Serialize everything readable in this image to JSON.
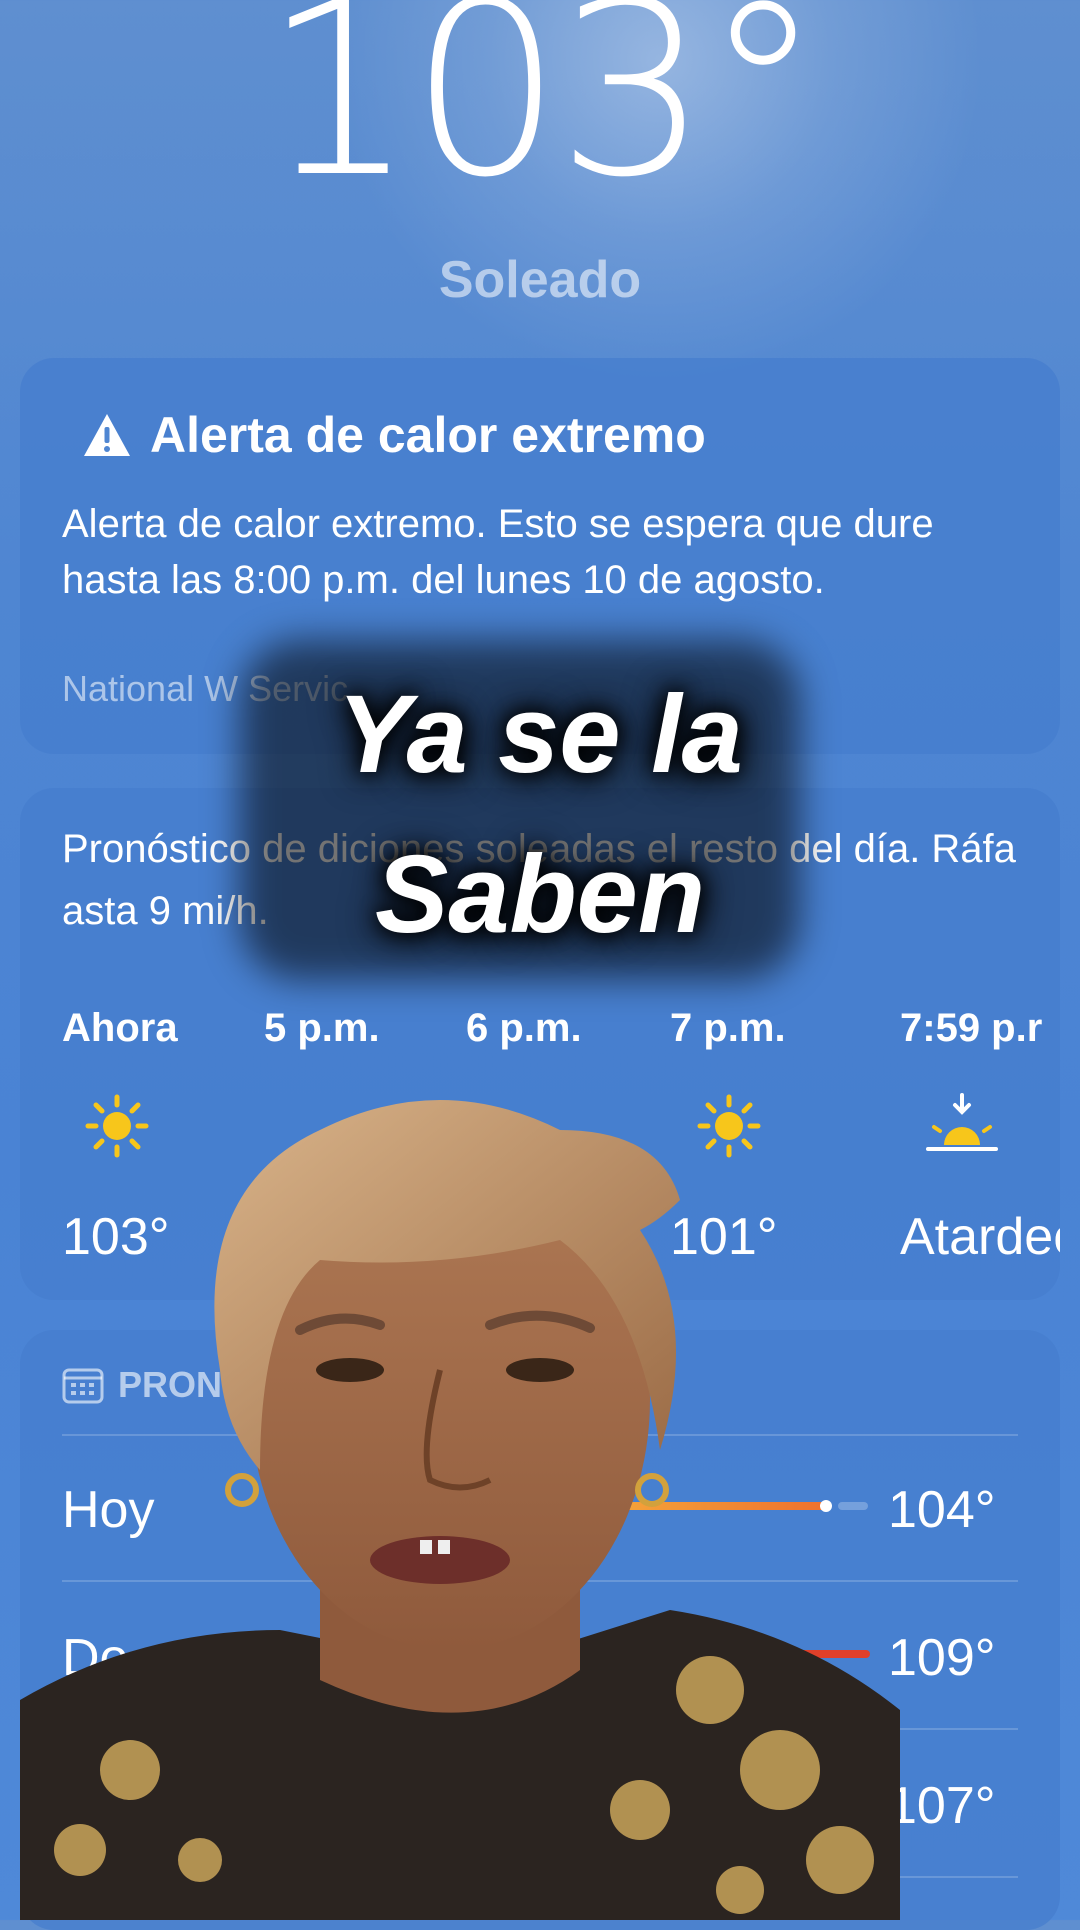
{
  "current": {
    "temperature": "103°",
    "condition": "Soleado"
  },
  "alert": {
    "title": "Alerta de calor extremo",
    "body": "Alerta de calor extremo. Esto se espera que dure hasta las 8:00 p.m. del lunes 10 de agosto.",
    "source": "National W      Servic"
  },
  "hourly": {
    "summary": "Pronóstico de       diciones soleadas el resto del día. Ráfa                         asta 9 mi/h.",
    "hours": [
      {
        "time": "Ahora",
        "icon": "sun-icon",
        "temp": "103°"
      },
      {
        "time": "5 p.m.",
        "icon": "sun-icon",
        "temp": ""
      },
      {
        "time": "6 p.m.",
        "icon": "sun-icon",
        "temp": ""
      },
      {
        "time": "7 p.m.",
        "icon": "sun-icon",
        "temp": "101°"
      },
      {
        "time": "7:59 p.r",
        "icon": "sunset-icon",
        "temp": "Atardec"
      }
    ]
  },
  "daily": {
    "header": "PRON",
    "days": [
      {
        "day": "Hoy",
        "high": "104°"
      },
      {
        "day": "Do",
        "high": "109°"
      },
      {
        "day": "",
        "high": "107°"
      }
    ]
  },
  "overlay": {
    "caption_line1": "Ya se la",
    "caption_line2": "Saben"
  },
  "colors": {
    "background": "#4f86d2",
    "sun": "#f7c61b",
    "bar_warm": "#f0702c",
    "bar_hot": "#e0402a"
  }
}
